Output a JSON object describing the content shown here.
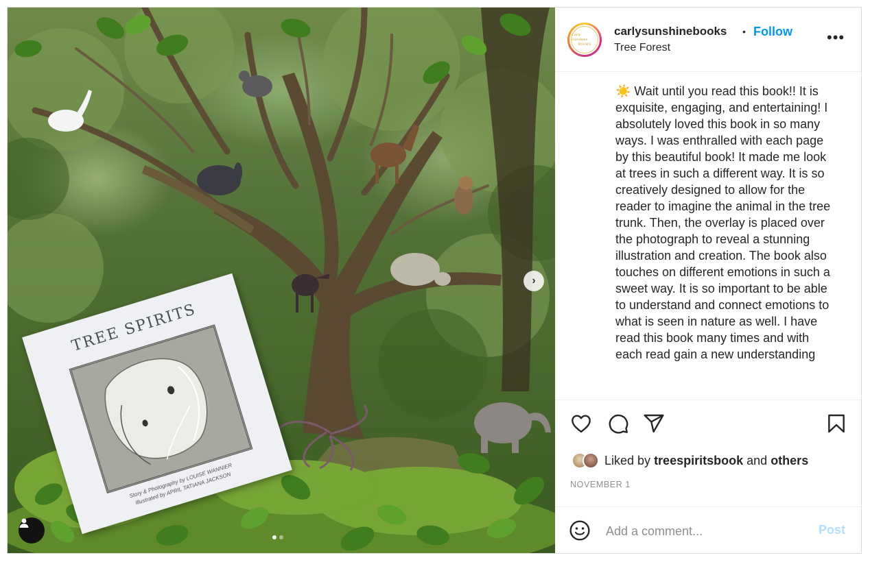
{
  "media": {
    "book": {
      "title": "TREE SPIRITS",
      "credit_line_1": "Story & Photography by LOUISE WANNIER",
      "credit_line_2": "Illustrated by APRIL TATIANA JACKSON"
    },
    "slides_total": 2,
    "slide_current": 1
  },
  "post": {
    "username": "carlysunshinebooks",
    "separator": "•",
    "follow_label": "Follow",
    "location": "Tree Forest",
    "more_label": "•••",
    "avatar_logo_top": "Carly Sunshine",
    "avatar_logo_bottom": "BOOKS",
    "caption": "☀️ Wait until you read this book!! It is exquisite, engaging, and entertaining! I absolutely loved this book in so many ways. I was enthralled with each page by this beautiful book! It made me look at trees in such a different way. It is so creatively designed to allow for the reader to imagine the animal in the tree trunk. Then, the overlay is placed over the photograph to reveal a stunning illustration and creation. The book also touches on different emotions in such a sweet way. It is so important to be able to understand and connect emotions to what is seen in nature as well. I have read this book many times and with each read gain a new understanding",
    "likes": {
      "prefix": "Liked by",
      "user": "treespiritsbook",
      "conjunction": "and",
      "others": "others"
    },
    "date": "NOVEMBER 1",
    "comment_placeholder": "Add a comment...",
    "post_label": "Post"
  },
  "icons": [
    "heart-icon",
    "comment-icon",
    "share-icon",
    "bookmark-icon",
    "emoji-icon",
    "chevron-right-icon",
    "user-icon",
    "more-icon"
  ],
  "colors": {
    "accent": "#0095f6",
    "post_disabled": "#b2dffc",
    "muted": "#8e8e8e",
    "text": "#262626",
    "border": "#dbdbdb"
  }
}
